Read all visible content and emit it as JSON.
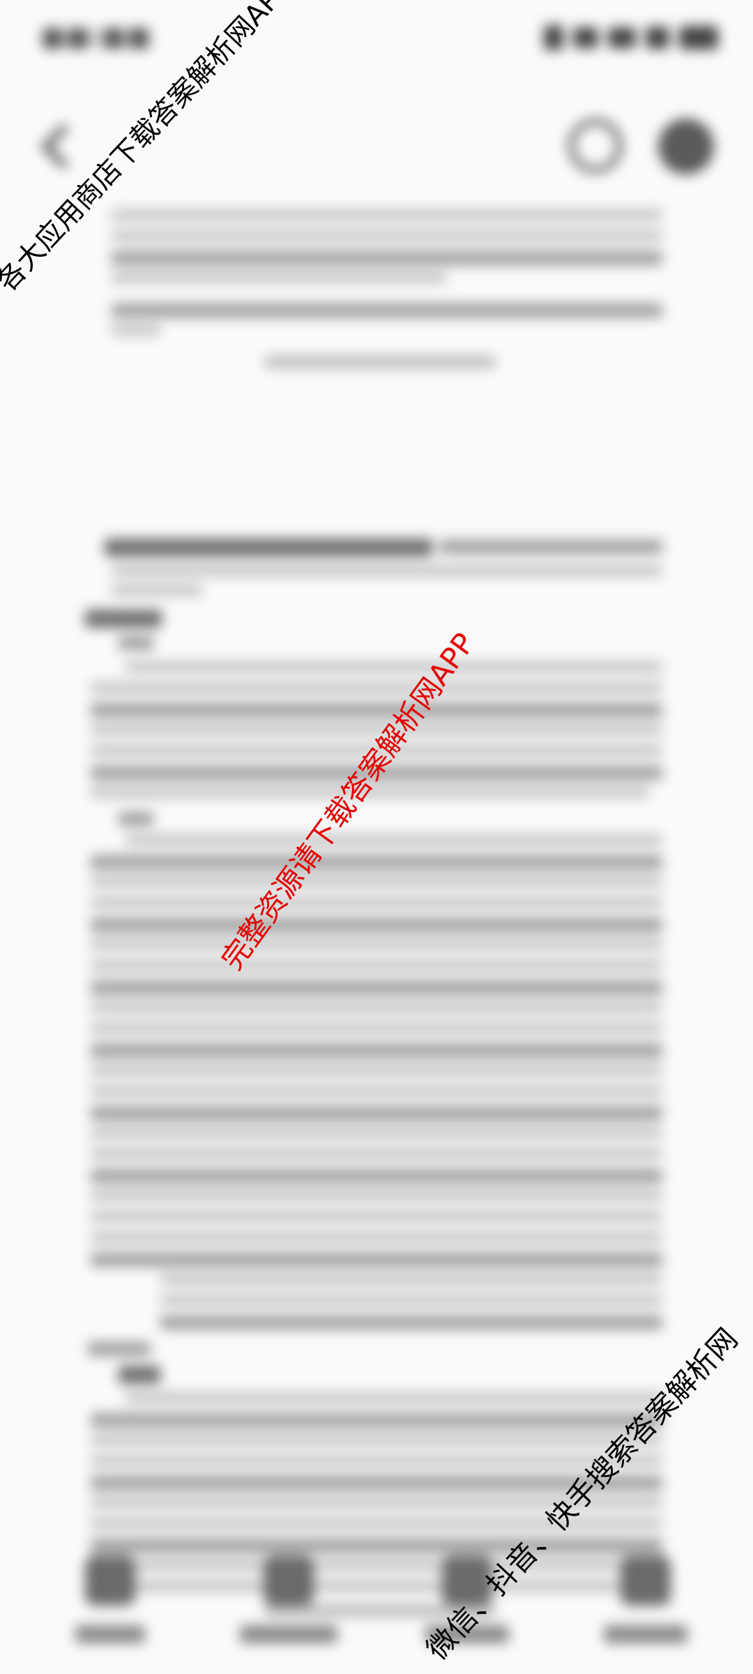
{
  "watermarks": {
    "top": "各大应用商店下载答案解析网APP",
    "center": "完整资源请下载答案解析网APP",
    "bottom": "微信、抖音、快手搜索答案解析网"
  },
  "icons": {
    "back": "back-arrow-icon",
    "history": "clock-icon",
    "menu": "grid-icon"
  },
  "colors": {
    "background": "#fafafa",
    "watermark_red": "#e60000",
    "watermark_black": "#000000"
  }
}
